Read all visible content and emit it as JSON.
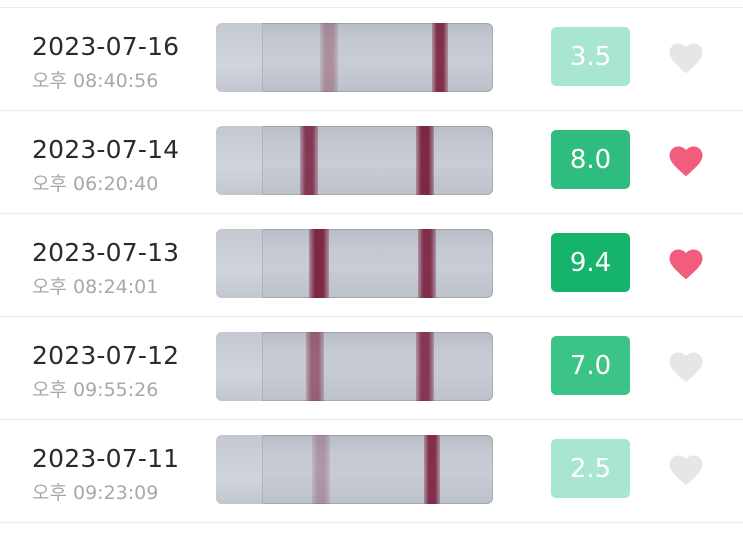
{
  "rows": [
    {
      "date": "2023-07-16",
      "time": "오후 08:40:56",
      "score": "3.5",
      "score_color": "#a8e6d0",
      "favorited": false,
      "control_line": {
        "intensity": 0.9
      },
      "test_line": {
        "intensity": 0.35
      }
    },
    {
      "date": "2023-07-14",
      "time": "오후 06:20:40",
      "score": "8.0",
      "score_color": "#2ebd7e",
      "favorited": true,
      "control_line": {
        "intensity": 0.95
      },
      "test_line": {
        "intensity": 0.85
      }
    },
    {
      "date": "2023-07-13",
      "time": "오후 08:24:01",
      "score": "9.4",
      "score_color": "#16b36d",
      "favorited": true,
      "control_line": {
        "intensity": 0.9
      },
      "test_line": {
        "intensity": 0.95
      }
    },
    {
      "date": "2023-07-12",
      "time": "오후 09:55:26",
      "score": "7.0",
      "score_color": "#3cc486",
      "favorited": false,
      "control_line": {
        "intensity": 0.85
      },
      "test_line": {
        "intensity": 0.6
      }
    },
    {
      "date": "2023-07-11",
      "time": "오후 09:23:09",
      "score": "2.5",
      "score_color": "#a8e6d0",
      "favorited": false,
      "control_line": {
        "intensity": 0.9
      },
      "test_line": {
        "intensity": 0.3
      }
    }
  ],
  "colors": {
    "heart_active": "#f25d7e",
    "heart_inactive": "#e6e6e6",
    "line_color": "#7a1f3d"
  },
  "icons": {
    "favorite": "heart-icon"
  }
}
